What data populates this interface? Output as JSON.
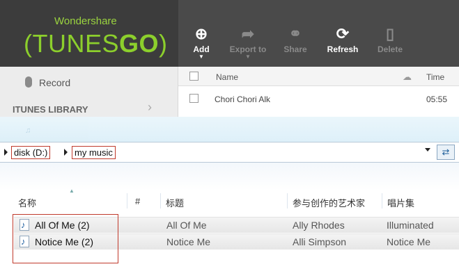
{
  "app": {
    "brand_top": "Wondershare",
    "brand_main_a": "(TUNES",
    "brand_main_b": "GO",
    "brand_main_c": ")",
    "toolbar": [
      {
        "label": "Add",
        "icon": "plus-circle-icon",
        "enabled": true
      },
      {
        "label": "Export to",
        "icon": "export-icon",
        "enabled": false
      },
      {
        "label": "Share",
        "icon": "share-icon",
        "enabled": false
      },
      {
        "label": "Refresh",
        "icon": "refresh-icon",
        "enabled": true
      },
      {
        "label": "Delete",
        "icon": "trash-icon",
        "enabled": false
      }
    ],
    "leftnav": {
      "record": "Record",
      "library": "ITUNES LIBRARY"
    },
    "songlist": {
      "col_name": "Name",
      "col_time": "Time",
      "rows": [
        {
          "name": "Chori Chori Alk",
          "time": "05:55"
        }
      ]
    }
  },
  "explorer": {
    "breadcrumb": [
      "disk (D:)",
      "my music"
    ],
    "columns": [
      "名称",
      "#",
      "标题",
      "参与创作的艺术家",
      "唱片集"
    ],
    "files": [
      {
        "name": "All Of Me (2)",
        "title": "All Of Me",
        "artist": "Ally Rhodes",
        "album": "Illuminated"
      },
      {
        "name": "Notice Me (2)",
        "title": "Notice Me",
        "artist": "Alli Simpson",
        "album": "Notice Me"
      }
    ]
  },
  "colors": {
    "brand_green": "#8ccf2c",
    "header_dark": "#3c3c3c",
    "highlight_red": "#c0392b"
  }
}
